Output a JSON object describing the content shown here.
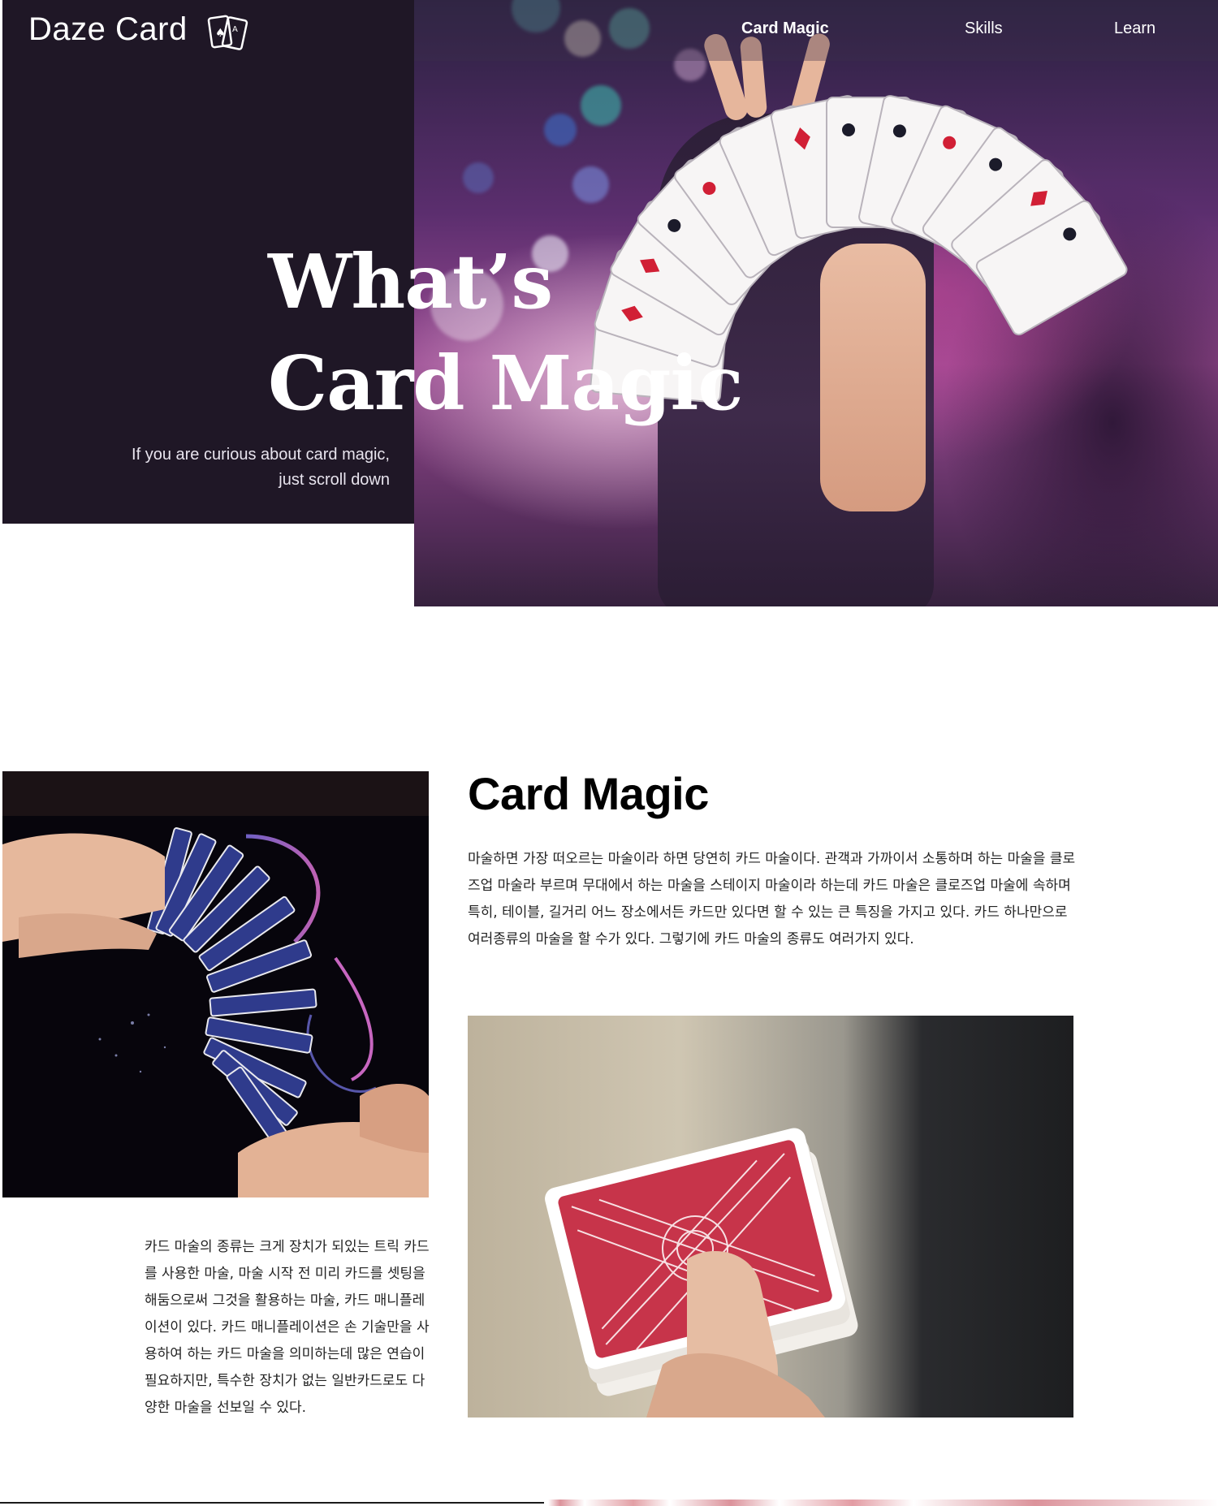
{
  "header": {
    "brand": "Daze Card",
    "nav": [
      {
        "label": "Card Magic",
        "active": true
      },
      {
        "label": "Skills",
        "active": false
      },
      {
        "label": "Learn",
        "active": false
      }
    ]
  },
  "hero": {
    "title_line1": "What’s",
    "title_line2": "Card Magic",
    "subtitle_line1": "If you are curious about card magic,",
    "subtitle_line2": "just scroll down"
  },
  "section": {
    "title": "Card Magic",
    "paragraph1": "마술하면 가장 떠오르는 마술이라 하면 당연히 카드 마술이다. 관객과 가까이서 소통하며 하는 마술을 클로즈업 마술라 부르며 무대에서 하는 마술을 스테이지 마술이라 하는데 카드 마술은 클로즈업 마술에 속하며 특히, 테이블, 길거리 어느 장소에서든 카드만 있다면 할 수 있는 큰 특징을 가지고 있다. 카드 하나만으로 여러종류의 마술을 할 수가 있다. 그렇기에 카드 마술의 종류도 여러가지 있다.",
    "paragraph2": "카드 마술의 종류는 크게 장치가 되있는 트릭 카드를 사용한 마술, 마술 시작 전 미리 카드를 셋팅을 해둠으로써 그것을 활용하는 마술, 카드 매니플레이션이 있다. 카드 매니플레이션은 손 기술만을 사용하여 하는 카드 마술을 의미하는데 많은 연습이 필요하지만, 특수한 장치가 없는 일반카드로도 다양한 마술을 선보일 수 있다."
  },
  "colors": {
    "hero_dark": "#1f1726",
    "accent_magenta": "#b44a9b",
    "text_dark": "#000000"
  },
  "icons": [
    "playing-cards-icon"
  ]
}
